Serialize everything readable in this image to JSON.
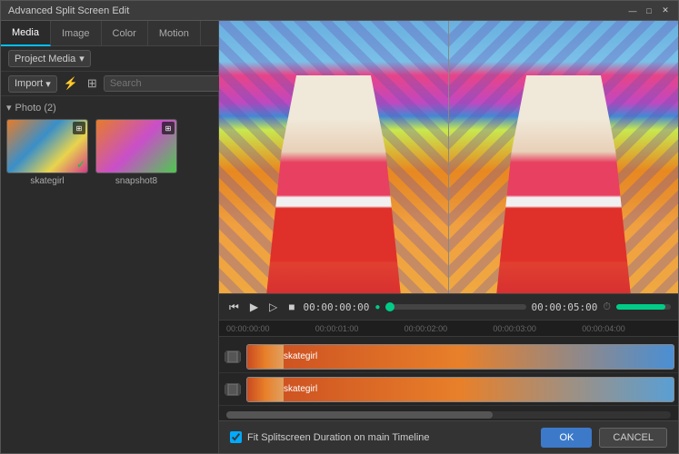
{
  "window": {
    "title": "Advanced Split Screen Edit",
    "controls": [
      "minimize",
      "maximize",
      "close"
    ]
  },
  "left_panel": {
    "tabs": [
      "Media",
      "Image",
      "Color",
      "Motion"
    ],
    "active_tab": "Media",
    "project_media_label": "Project Media",
    "toolbar": {
      "import_label": "Import",
      "search_placeholder": "Search"
    },
    "sections": [
      {
        "name": "Photo",
        "count": 2,
        "items": [
          {
            "name": "skategirl",
            "has_check": true
          },
          {
            "name": "snapshot8",
            "has_check": false
          }
        ]
      }
    ]
  },
  "playback": {
    "time_current": "00:00:00:00",
    "time_total": "00:00:05:00"
  },
  "timeline": {
    "ruler_ticks": [
      "00:00:00:00",
      "00:00:01:00",
      "00:00:02:00",
      "00:00:03:00",
      "00:00:04:00",
      ""
    ],
    "tracks": [
      {
        "label": "skategirl"
      },
      {
        "label": "skategirl"
      }
    ]
  },
  "bottom_bar": {
    "fit_checkbox_label": "Fit Splitscreen Duration on main Timeline",
    "fit_checked": true,
    "ok_label": "OK",
    "cancel_label": "CANCEL"
  }
}
